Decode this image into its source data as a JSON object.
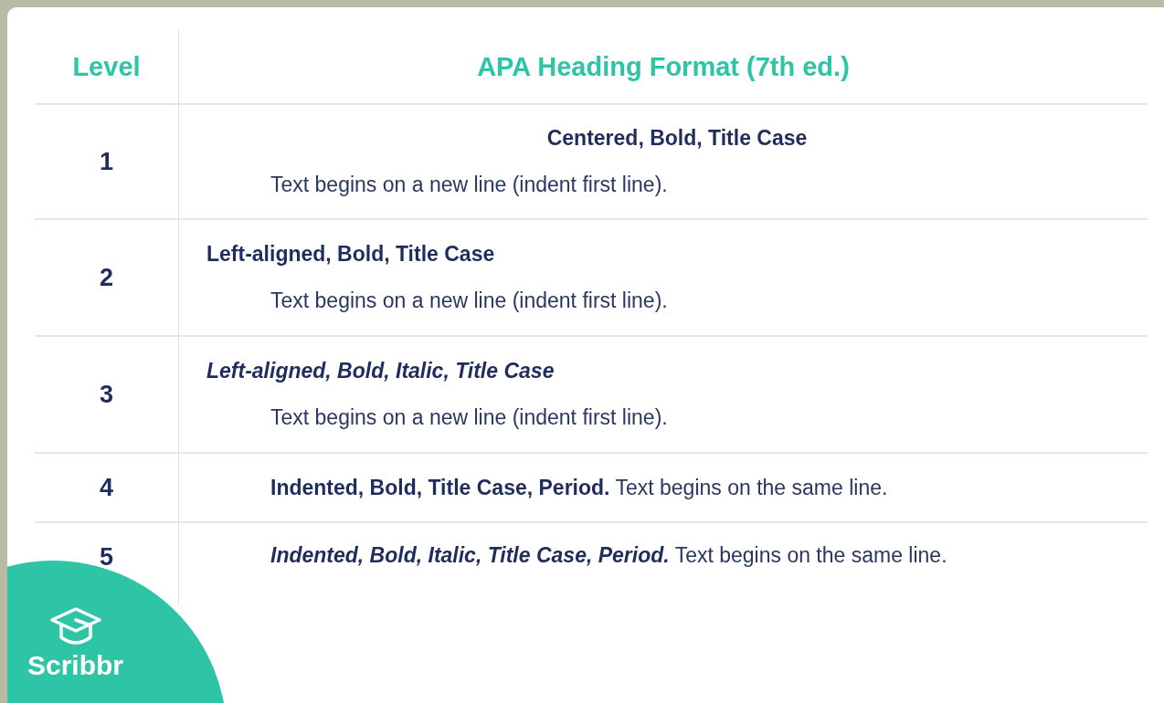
{
  "table": {
    "columns": [
      "Level",
      "APA Heading Format (7th ed.)"
    ],
    "rows": [
      {
        "level": "1",
        "kind": "stacked",
        "centered": true,
        "italic": false,
        "heading": "Centered, Bold, Title Case",
        "body": "Text begins on a new line (indent first line)."
      },
      {
        "level": "2",
        "kind": "stacked",
        "centered": false,
        "italic": false,
        "heading": "Left-aligned, Bold, Title Case",
        "body": "Text begins on a new line (indent first line)."
      },
      {
        "level": "3",
        "kind": "stacked",
        "centered": false,
        "italic": true,
        "heading": "Left-aligned, Bold, Italic, Title Case",
        "body": "Text begins on a new line (indent first line)."
      },
      {
        "level": "4",
        "kind": "run-in",
        "italic": false,
        "heading": "Indented, Bold, Title Case, Period.",
        "body": "Text begins on the same line."
      },
      {
        "level": "5",
        "kind": "run-in",
        "italic": true,
        "heading": "Indented, Bold, Italic, Title Case, Period.",
        "body": "Text begins on the same line."
      }
    ]
  },
  "logo": {
    "text": "Scribbr"
  }
}
